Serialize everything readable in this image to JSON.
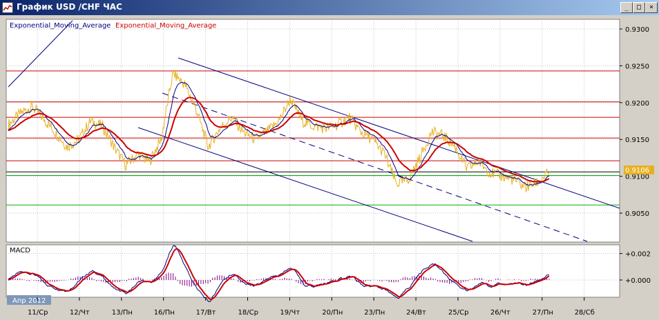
{
  "window": {
    "title": "График USD /CHF ЧАС",
    "buttons": {
      "minimize": "_",
      "maximize": "□",
      "close": "×"
    }
  },
  "indicators": {
    "ema_a": "Exponential_Moving_Average",
    "ema_b": "Exponential_Moving_Average",
    "macd_label": "MACD"
  },
  "price_axis": {
    "ticks": [
      "0.9300",
      "0.9250",
      "0.9200",
      "0.9150",
      "0.9100",
      "0.9050"
    ],
    "current_price": "0.9106"
  },
  "macd_axis": {
    "ticks": [
      "+0.002",
      "+0.000"
    ]
  },
  "period_badge": "Апр 2012",
  "date_axis": [
    "11/Ср",
    "12/Чт",
    "13/Пн",
    "16/Пн",
    "17/Вт",
    "18/Ср",
    "19/Чт",
    "20/Пн",
    "23/Пн",
    "24/Вт",
    "25/Ср",
    "26/Чт",
    "27/Пн",
    "28/Сб"
  ],
  "colors": {
    "background": "#ffffff",
    "grid": "#c0c0c0",
    "price": "#e8b020",
    "ema_fast": "#000080",
    "ema_slow": "#cc0000",
    "hline_red": "#cc0000",
    "hline_green": "#00b000",
    "hline_black": "#000000",
    "channel": "#000080",
    "macd_hist": "#800080",
    "current_price_badge": "#e8b020"
  },
  "chart_data": {
    "type": "line",
    "price_levels": {
      "red": [
        0.9243,
        0.9201,
        0.918,
        0.9152,
        0.9121
      ],
      "black": 0.9106,
      "green": [
        0.9101,
        0.9061
      ]
    },
    "close": [
      0.917,
      0.9185,
      0.9195,
      0.9178,
      0.916,
      0.914,
      0.915,
      0.9175,
      0.9168,
      0.914,
      0.9115,
      0.913,
      0.912,
      0.915,
      0.924,
      0.9225,
      0.919,
      0.914,
      0.9165,
      0.918,
      0.916,
      0.915,
      0.916,
      0.9175,
      0.9205,
      0.9175,
      0.9168,
      0.9165,
      0.917,
      0.918,
      0.916,
      0.915,
      0.913,
      0.909,
      0.9095,
      0.9125,
      0.916,
      0.9155,
      0.914,
      0.911,
      0.912,
      0.9105,
      0.91,
      0.9095,
      0.9085,
      0.9092,
      0.9105
    ]
  }
}
